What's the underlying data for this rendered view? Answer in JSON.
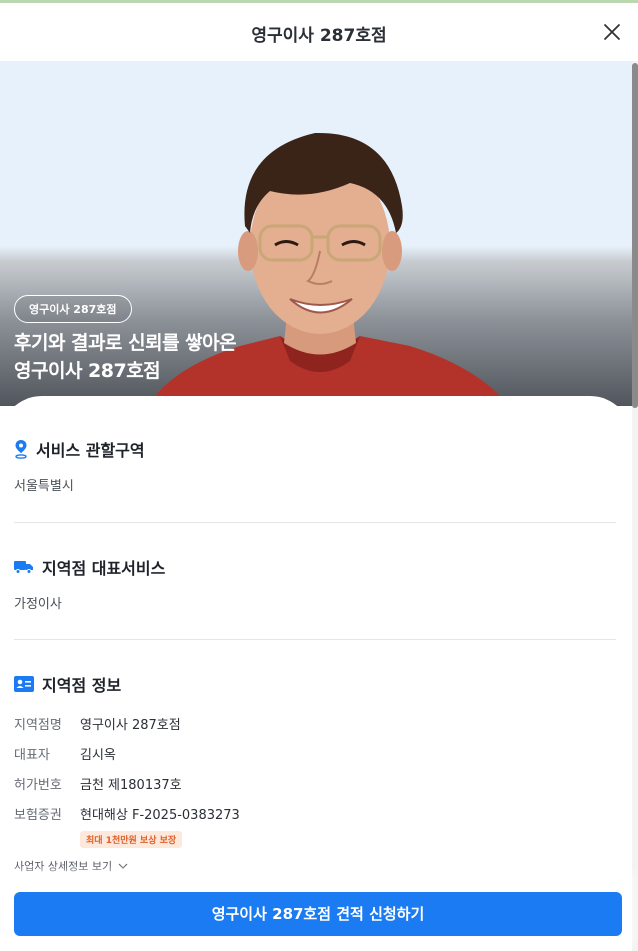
{
  "header": {
    "title": "영구이사 287호점",
    "close_icon": "close-icon"
  },
  "hero": {
    "badge": "영구이사 287호점",
    "headline_line1": "후기와 결과로 신뢰를 쌓아온",
    "headline_line2": "영구이사 287호점"
  },
  "sections": {
    "service_area": {
      "title": "서비스 관할구역",
      "value": "서울특별시",
      "icon": "location-pin-icon"
    },
    "main_service": {
      "title": "지역점 대표서비스",
      "value": "가정이사",
      "icon": "truck-icon"
    },
    "branch_info": {
      "title": "지역점 정보",
      "icon": "id-card-icon",
      "rows": [
        {
          "label": "지역점명",
          "value": "영구이사 287호점"
        },
        {
          "label": "대표자",
          "value": "김시옥"
        },
        {
          "label": "허가번호",
          "value": "금천 제180137호"
        },
        {
          "label": "보험증권",
          "value": "현대해상 F-2025-0383273"
        }
      ],
      "insurance_badge": "최대 1천만원 보상 보장"
    }
  },
  "details_link": {
    "label": "사업자 상세정보 보기",
    "icon": "chevron-down-icon"
  },
  "cta": {
    "label": "영구이사 287호점 견적 신청하기"
  },
  "colors": {
    "accent": "#1b7bf2",
    "badge_bg": "#fde8dc",
    "badge_text": "#e0612a"
  }
}
